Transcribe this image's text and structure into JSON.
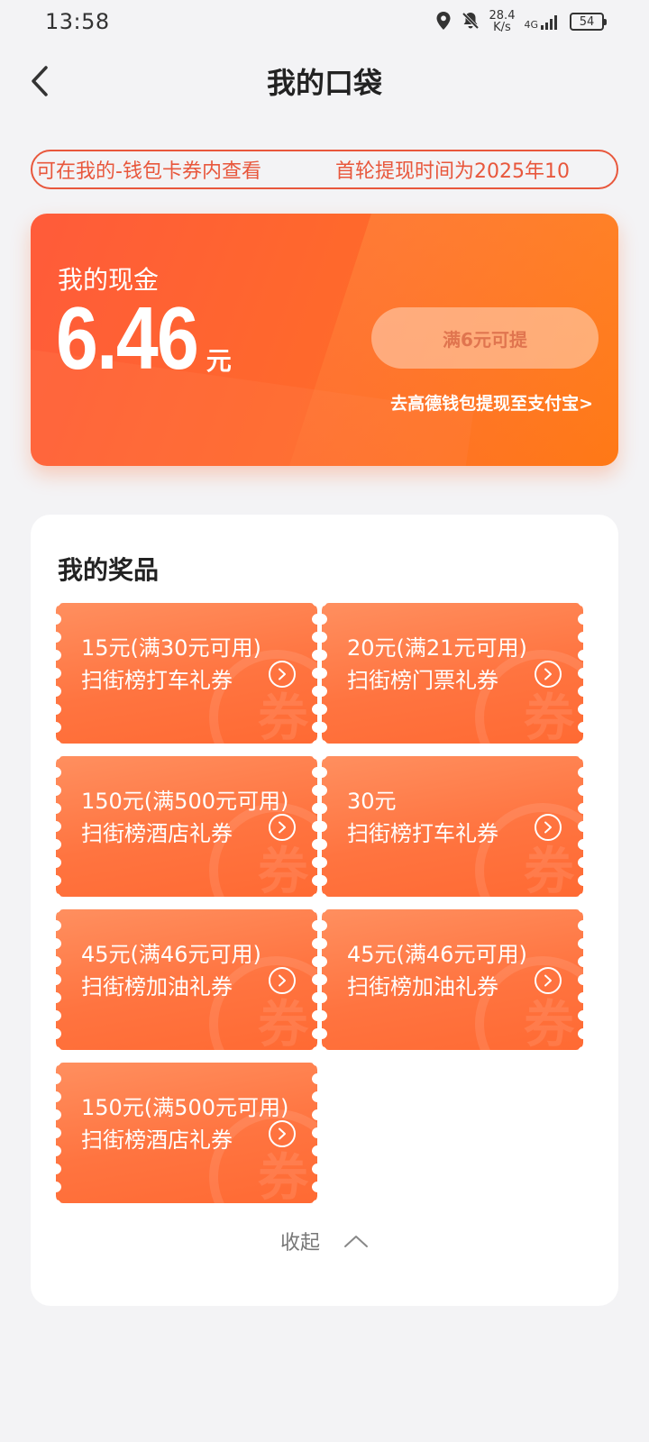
{
  "status_bar": {
    "time": "13:58",
    "net_speed_value": "28.4",
    "net_speed_unit": "K/s",
    "signal_label": "4G",
    "battery": "54"
  },
  "header": {
    "title": "我的口袋"
  },
  "notice": {
    "messages": [
      "可在我的-钱包卡券内查看",
      "首轮提现时间为2025年10"
    ]
  },
  "cash": {
    "label": "我的现金",
    "amount": "6.46",
    "unit": "元",
    "withdraw_button": "满6元可提",
    "wallet_link": "去高德钱包提现至支付宝>"
  },
  "prizes": {
    "title": "我的奖品",
    "coupons": [
      {
        "value": "15元(满30元可用)",
        "name": "扫街榜打车礼券"
      },
      {
        "value": "20元(满21元可用)",
        "name": "扫街榜门票礼券"
      },
      {
        "value": "150元(满500元可用)",
        "name": "扫街榜酒店礼券"
      },
      {
        "value": "30元",
        "name": "扫街榜打车礼券"
      },
      {
        "value": "45元(满46元可用)",
        "name": "扫街榜加油礼券"
      },
      {
        "value": "45元(满46元可用)",
        "name": "扫街榜加油礼券"
      },
      {
        "value": "150元(满500元可用)",
        "name": "扫街榜酒店礼券"
      }
    ],
    "watermark_char": "券",
    "collapse_label": "收起"
  },
  "colors": {
    "accent": "#ff6a2a",
    "notice_border": "#e8573c",
    "coupon_top": "#ff8f5f",
    "coupon_bottom": "#ff6a33"
  },
  "icons": {
    "back": "chevron-left-icon",
    "coupon_go": "circle-chevron-right-icon",
    "collapse": "chevron-up-icon"
  }
}
